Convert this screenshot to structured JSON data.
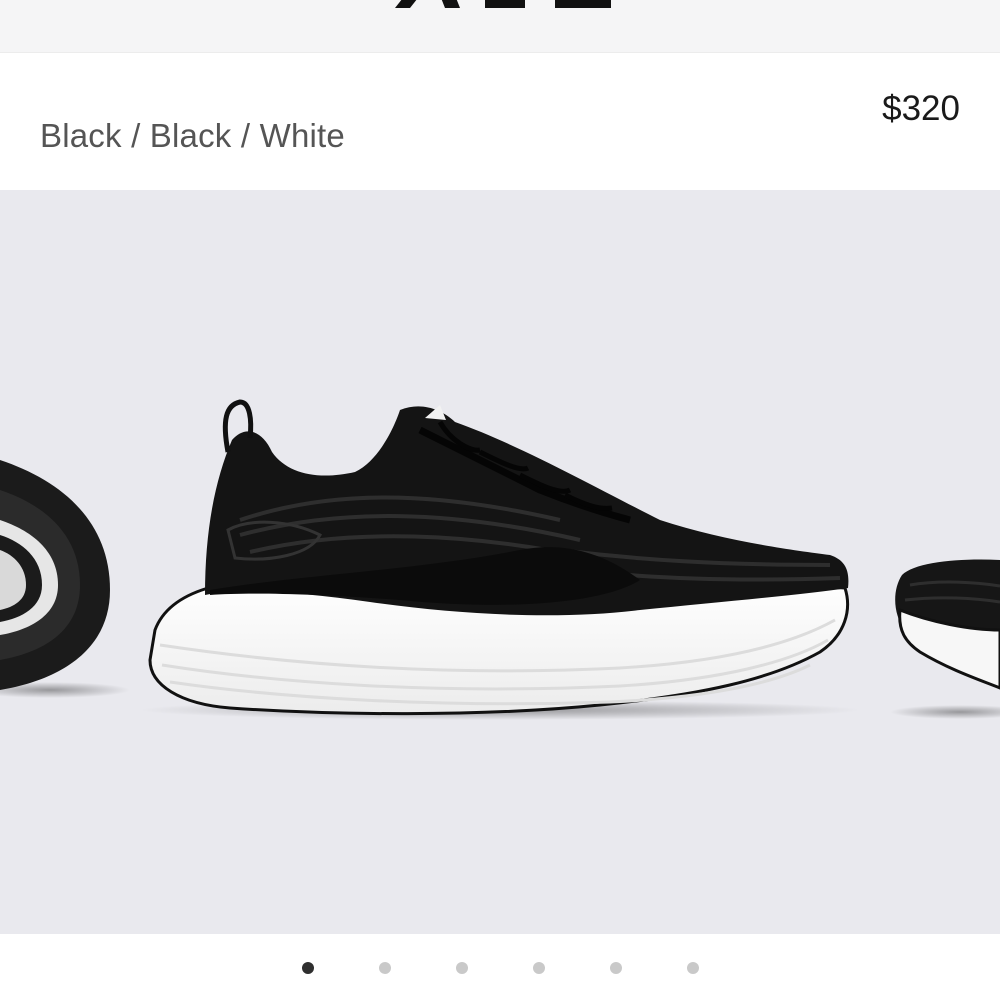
{
  "header": {
    "logo_icon": "ape-logo-icon"
  },
  "product": {
    "variant": "Black / Black / White",
    "price": "$320"
  },
  "gallery": {
    "image_icon": "sneaker-image",
    "slide_count": 6,
    "active_slide": 1
  },
  "colors": {
    "header_bg": "#f5f5f6",
    "gallery_bg": "#e9e9ee",
    "dot_active": "#2f2f2f",
    "dot_inactive": "#c9c9c9"
  }
}
